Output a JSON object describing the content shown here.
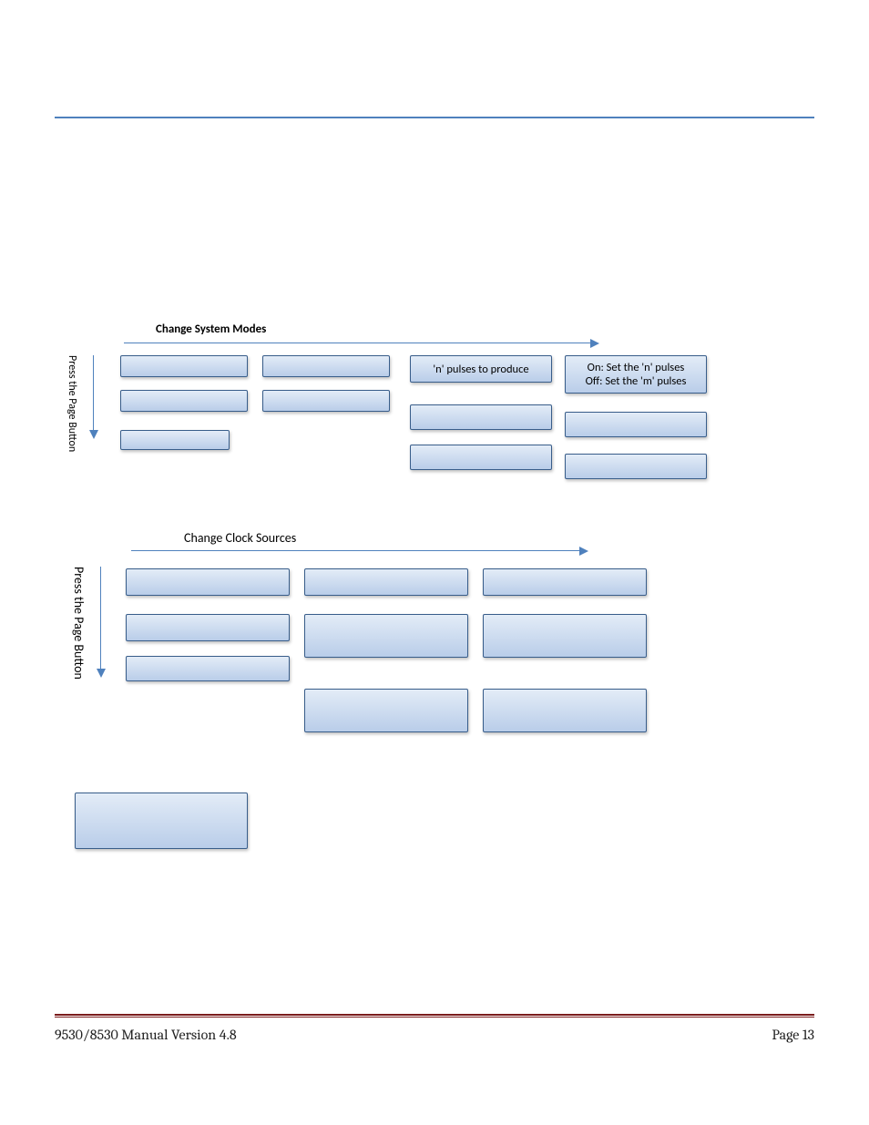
{
  "diagram1": {
    "topArrowLabel": "Change System Modes",
    "sideLabel": "Press the Page Button",
    "col3_row1": "'n' pulses to produce",
    "col4_row1": "On: Set the 'n' pulses\nOff: Set the 'm' pulses"
  },
  "diagram2": {
    "topArrowLabel": "Change Clock Sources",
    "sideLabel": "Press the Page Button"
  },
  "footer": {
    "left": "9530/8530 Manual Version 4.8",
    "right": "Page 13"
  }
}
